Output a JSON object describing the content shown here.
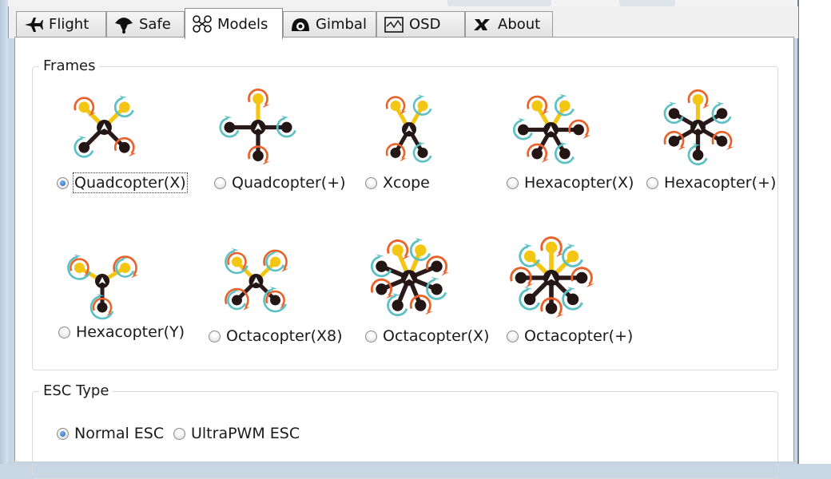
{
  "tabs": [
    {
      "label": "Flight",
      "icon": "plane-icon",
      "active": false
    },
    {
      "label": "Safe",
      "icon": "parachute-icon",
      "active": false
    },
    {
      "label": "Models",
      "icon": "quadcopter-icon",
      "active": true
    },
    {
      "label": "Gimbal",
      "icon": "gimbal-icon",
      "active": false
    },
    {
      "label": "OSD",
      "icon": "osd-icon",
      "active": false
    },
    {
      "label": "About",
      "icon": "about-logo-icon",
      "active": false
    }
  ],
  "frames_group": {
    "title": "Frames",
    "selected": "Quadcopter(X)",
    "options": [
      {
        "label": "Quadcopter(X)",
        "selected": true,
        "motors": 4,
        "layout": "x"
      },
      {
        "label": "Quadcopter(+)",
        "selected": false,
        "motors": 4,
        "layout": "plus"
      },
      {
        "label": "Xcope",
        "selected": false,
        "motors": 4,
        "layout": "xcope"
      },
      {
        "label": "Hexacopter(X)",
        "selected": false,
        "motors": 6,
        "layout": "x"
      },
      {
        "label": "Hexacopter(+)",
        "selected": false,
        "motors": 6,
        "layout": "plus"
      },
      {
        "label": "Hexacopter(Y)",
        "selected": false,
        "motors": 6,
        "layout": "y"
      },
      {
        "label": "Octacopter(X8)",
        "selected": false,
        "motors": 8,
        "layout": "x8"
      },
      {
        "label": "Octacopter(X)",
        "selected": false,
        "motors": 8,
        "layout": "x"
      },
      {
        "label": "Octacopter(+)",
        "selected": false,
        "motors": 8,
        "layout": "plus"
      }
    ]
  },
  "esc_group": {
    "title": "ESC Type",
    "options": [
      {
        "label": "Normal ESC",
        "selected": true
      },
      {
        "label": "UltraPWM ESC",
        "selected": false
      }
    ]
  },
  "colors": {
    "arm": "#2a1a1a",
    "motor": "#231514",
    "front_motor": "#f3c613",
    "cw_arrow": "#e8622a",
    "ccw_arrow": "#5cc0c4",
    "selected_radio": "#1f5fb8"
  }
}
